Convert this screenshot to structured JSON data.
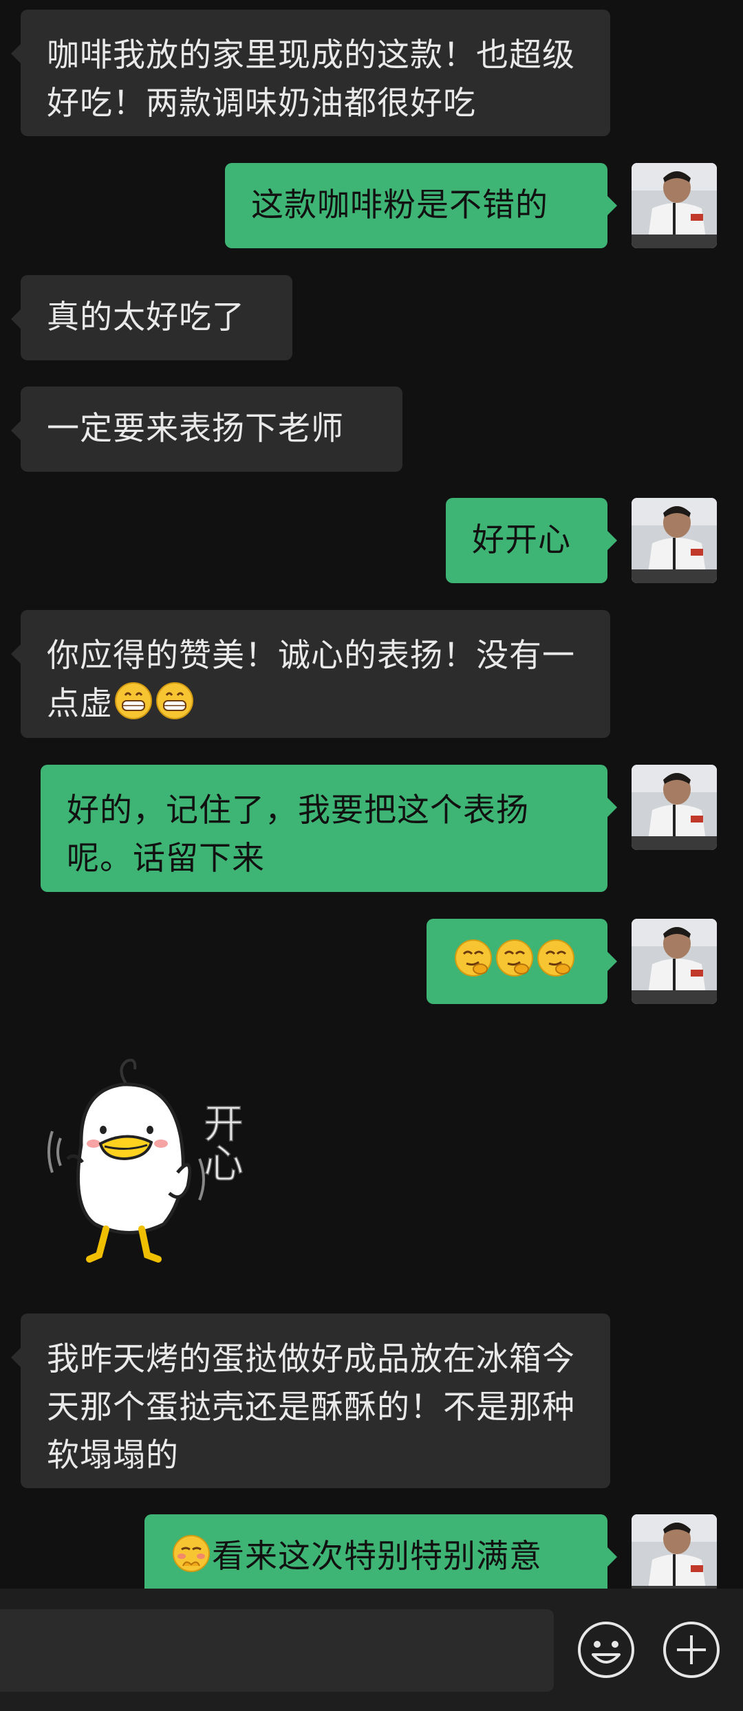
{
  "messages": [
    {
      "side": "in",
      "text": "咖啡我放的家里现成的这款！也超级好吃！两款调味奶油都很好吃"
    },
    {
      "side": "out",
      "text": "这款咖啡粉是不错的"
    },
    {
      "side": "in",
      "text": "真的太好吃了"
    },
    {
      "side": "in",
      "text": "一定要来表扬下老师"
    },
    {
      "side": "out",
      "text": "好开心"
    },
    {
      "side": "in",
      "text": "你应得的赞美！诚心的表扬！没有一点虚",
      "emoji": "grin-emoji"
    },
    {
      "side": "out",
      "text": "好的，记住了，我要把这个表扬呢。话留下来"
    },
    {
      "side": "out",
      "emoji": "smirk-emoji"
    },
    {
      "side": "in",
      "sticker": "happy-duck-sticker",
      "sticker_text": "开心"
    },
    {
      "side": "in",
      "text": "我昨天烤的蛋挞做好成品放在冰箱今天那个蛋挞壳还是酥酥的！不是那种软塌塌的"
    },
    {
      "side": "out",
      "text": "看来这次特别特别满意",
      "emoji": "shy-emoji"
    }
  ],
  "toolbar": {
    "emoji_button_icon": "smiley-icon",
    "more_button_icon": "plus-icon"
  },
  "colors": {
    "background": "#111111",
    "incoming_bubble": "#2c2c2c",
    "outgoing_bubble": "#3eb575",
    "text_light": "#e9e9e9",
    "input_bar": "#1e1e1e"
  }
}
